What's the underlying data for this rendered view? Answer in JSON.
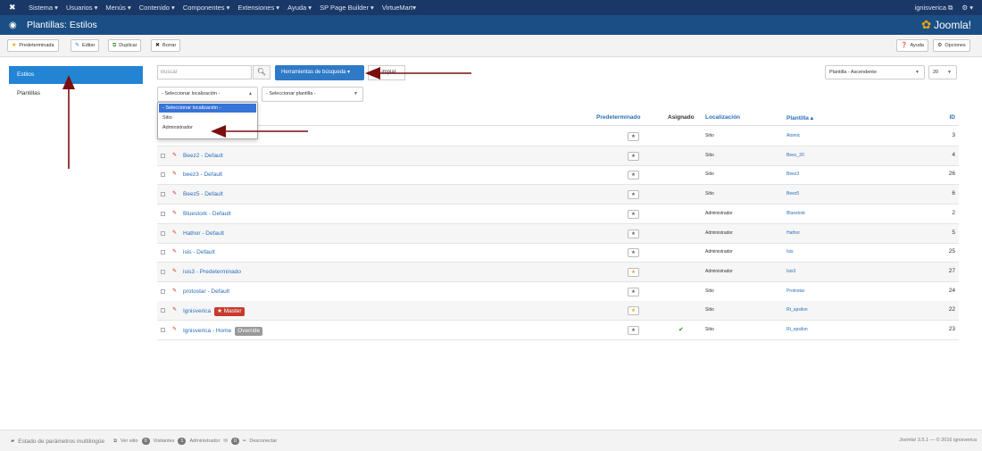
{
  "navbar": {
    "menu": [
      "Sistema ▾",
      "Usuarios ▾",
      "Menús ▾",
      "Contenido ▾",
      "Componentes ▾",
      "Extensiones ▾",
      "Ayuda ▾",
      "SP Page Builder ▾",
      "VirtueMart▾"
    ],
    "user": "ignisverica ⧉",
    "settings": "⚙ ▾"
  },
  "titlebar": {
    "title": "Plantillas: Estilos",
    "brand": "Joomla!"
  },
  "toolbar": {
    "default": "Predeterminada",
    "edit": "Editar",
    "duplicate": "Duplicar",
    "delete": "Borrar",
    "help": "Ayuda",
    "options": "Opciones"
  },
  "sidebar": {
    "styles": "Estilos",
    "templates": "Plantillas"
  },
  "filters": {
    "search_placeholder": "Buscar",
    "search_tools": "Herramientas de búsqueda ▾",
    "clear": "Limpiar",
    "sort": "Plantilla - Ascendente",
    "limit": "20",
    "location_select": "- Seleccionar localización -",
    "template_select": "- Seleccionar plantilla -",
    "location_options": [
      "- Seleccionar localización -",
      "Sitio",
      "Administrador"
    ]
  },
  "table": {
    "headers": {
      "default": "Predeterminado",
      "assigned": "Asignado",
      "location": "Localización",
      "template": "Plantilla ▴",
      "id": "ID"
    },
    "rows": [
      {
        "name": "",
        "badge": "",
        "default": false,
        "assigned": false,
        "location": "Sitio",
        "template": "Atomic",
        "id": "3"
      },
      {
        "name": "Beez2 - Default",
        "badge": "",
        "default": false,
        "assigned": false,
        "location": "Sitio",
        "template": "Beez_20",
        "id": "4"
      },
      {
        "name": "beez3 - Default",
        "badge": "",
        "default": false,
        "assigned": false,
        "location": "Sitio",
        "template": "Beez3",
        "id": "26"
      },
      {
        "name": "Beez5 - Default",
        "badge": "",
        "default": false,
        "assigned": false,
        "location": "Sitio",
        "template": "Beez5",
        "id": "6"
      },
      {
        "name": "Bluestork - Default",
        "badge": "",
        "default": false,
        "assigned": false,
        "location": "Administrador",
        "template": "Bluestork",
        "id": "2"
      },
      {
        "name": "Hathor - Default",
        "badge": "",
        "default": false,
        "assigned": false,
        "location": "Administrador",
        "template": "Hathor",
        "id": "5"
      },
      {
        "name": "isis - Default",
        "badge": "",
        "default": false,
        "assigned": false,
        "location": "Administrador",
        "template": "Isis",
        "id": "25"
      },
      {
        "name": "isis3 - Predeterminado",
        "badge": "",
        "default": true,
        "assigned": false,
        "location": "Administrador",
        "template": "Isis3",
        "id": "27"
      },
      {
        "name": "protostar - Default",
        "badge": "",
        "default": false,
        "assigned": false,
        "location": "Sitio",
        "template": "Protostar",
        "id": "24"
      },
      {
        "name": "Ignisverica",
        "badge": "★ Master",
        "default": true,
        "assigned": false,
        "location": "Sitio",
        "template": "Rt_epsilon",
        "id": "22"
      },
      {
        "name": "Ignisverica - Home",
        "badge": "Override",
        "default": false,
        "assigned": true,
        "location": "Sitio",
        "template": "Rt_epsilon",
        "id": "23"
      }
    ]
  },
  "footer": {
    "multilang": "Estado de parámetros multilingüe",
    "view_site": "Ver sitio",
    "visitors_count": "0",
    "visitors": "Visitantes",
    "admin_count": "1",
    "admin": "Administrador",
    "messages_count": "0",
    "logout": "Desconectar",
    "version": "Joomla! 3.5.1 — © 2016 ignisverica"
  },
  "colors": {
    "navbar": "#1a3867",
    "titlebar": "#1b4e85",
    "accent": "#2384d3",
    "arrow": "#7a0f0f"
  }
}
